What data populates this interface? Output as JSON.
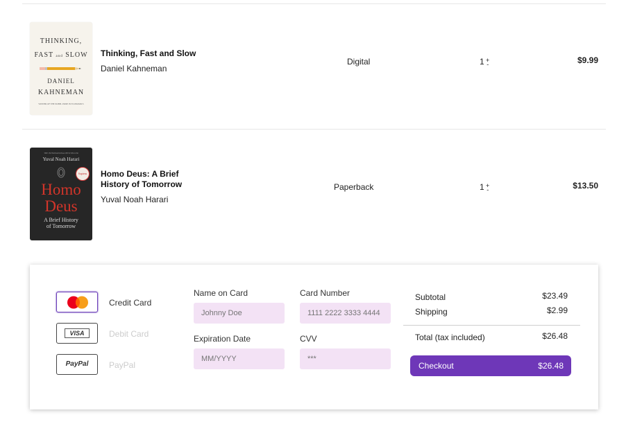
{
  "cart": {
    "items": [
      {
        "title": "Thinking, Fast and Slow",
        "author": "Daniel Kahneman",
        "format": "Digital",
        "quantity": "1",
        "price": "$9.99",
        "cover": {
          "line1": "THINKING,",
          "line2": "FAST",
          "line2b": "SLOW",
          "line2_small": "and",
          "author1": "DANIEL",
          "author2": "KAHNEMAN",
          "tagline": "WINNER OF THE NOBEL PRIZE IN ECONOMICS"
        }
      },
      {
        "title": "Homo Deus: A Brief History of Tomorrow",
        "author": "Yuval Noah Harari",
        "format": "Paperback",
        "quantity": "1",
        "price": "$13.50",
        "cover": {
          "top_line": "THE INTERNATIONAL BESTSELLER",
          "author": "Yuval Noah Harari",
          "word1": "Homo",
          "word2": "Deus",
          "sub1": "A Brief History",
          "sub2": "of Tomorrow",
          "badge": "Sapiens"
        }
      }
    ],
    "stepper": {
      "up": "+",
      "down": "-"
    }
  },
  "payment": {
    "methods": [
      {
        "label": "Credit Card",
        "logo": "Mastercard",
        "icon": "mastercard-icon",
        "selected": true
      },
      {
        "label": "Debit Card",
        "logo": "VISA",
        "icon": "visa-icon",
        "selected": false
      },
      {
        "label": "PayPal",
        "logo": "PayPal",
        "icon": "paypal-icon",
        "selected": false
      }
    ],
    "fields": {
      "name_label": "Name on Card",
      "name_placeholder": "Johnny Doe",
      "number_label": "Card Number",
      "number_placeholder": "1111 2222 3333 4444",
      "expiry_label": "Expiration Date",
      "expiry_placeholder": "MM/YYYY",
      "cvv_label": "CVV",
      "cvv_placeholder": "***"
    }
  },
  "summary": {
    "subtotal_label": "Subtotal",
    "subtotal": "$23.49",
    "shipping_label": "Shipping",
    "shipping": "$2.99",
    "total_label": "Total (tax included)",
    "total": "$26.48",
    "checkout_label": "Checkout",
    "checkout_amount": "$26.48"
  },
  "colors": {
    "accent": "#6e37b8",
    "input_bg": "#f3e2f5",
    "disabled_text": "#cccccc",
    "mastercard_red": "#eb001b",
    "mastercard_orange": "#f79e1b"
  }
}
